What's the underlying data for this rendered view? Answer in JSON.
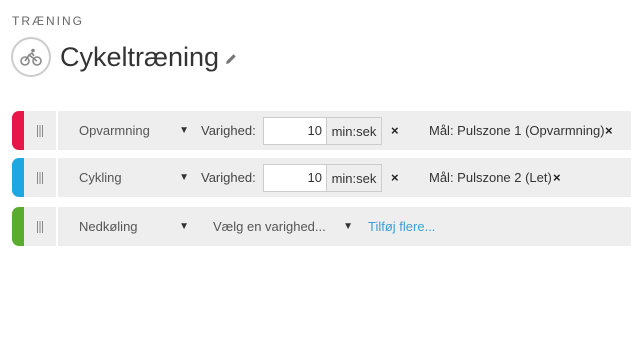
{
  "header": {
    "section_label": "TRÆNING",
    "title": "Cykeltræning"
  },
  "steps": [
    {
      "color": "#e8174a",
      "type": "Opvarmning",
      "duration_label": "Varighed:",
      "duration_value": "10",
      "duration_unit": "min:sek",
      "remove_duration": "×",
      "goal": "Mål: Pulszone 1 (Opvarmning)",
      "remove_goal": "×"
    },
    {
      "color": "#1ea7e1",
      "type": "Cykling",
      "duration_label": "Varighed:",
      "duration_value": "10",
      "duration_unit": "min:sek",
      "remove_duration": "×",
      "goal": "Mål: Pulszone 2 (Let)",
      "remove_goal": "×"
    },
    {
      "color": "#5aac2e",
      "type": "Nedkøling",
      "duration_placeholder": "Vælg en varighed...",
      "add_more": "Tilføj flere..."
    }
  ],
  "icons": {
    "header": "bike-icon",
    "edit": "pencil-icon",
    "drag": "drag-handle-icon",
    "dropdown": "chevron-down-icon"
  }
}
